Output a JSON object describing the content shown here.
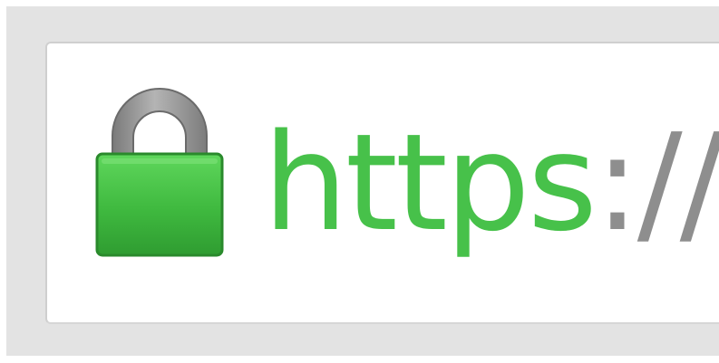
{
  "address_bar": {
    "lock_icon": "padlock-icon",
    "secure_color": "#47c14a",
    "separator_color": "#8e8e8e",
    "scheme": "https",
    "separator": "://"
  }
}
